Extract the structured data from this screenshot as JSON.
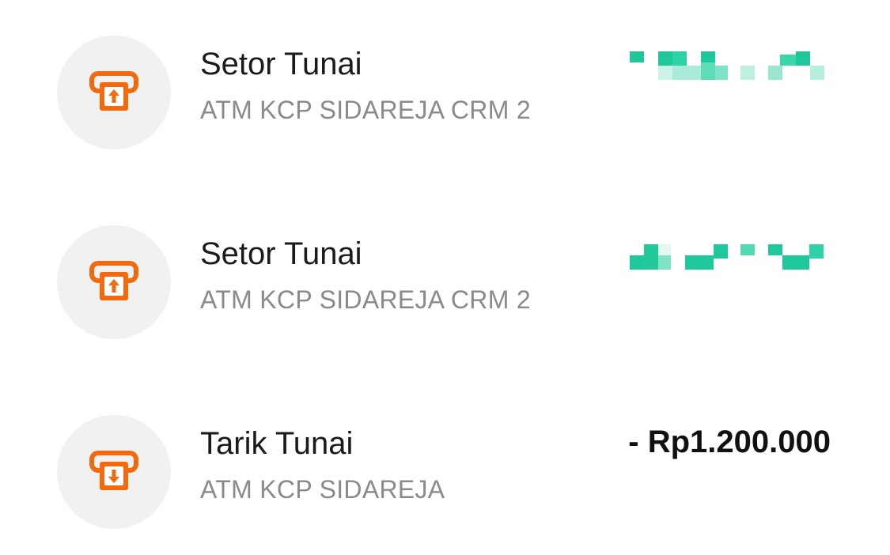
{
  "transactions": [
    {
      "icon": "atm-deposit-icon",
      "title": "Setor Tunai",
      "subtitle": "ATM KCP SIDAREJA CRM 2",
      "amount": "",
      "amount_masked": true
    },
    {
      "icon": "atm-deposit-icon",
      "title": "Setor Tunai",
      "subtitle": "ATM KCP SIDAREJA CRM 2",
      "amount": "",
      "amount_masked": true
    },
    {
      "icon": "atm-withdraw-icon",
      "title": "Tarik Tunai",
      "subtitle": "ATM KCP SIDAREJA",
      "amount": "- Rp1.200.000",
      "amount_masked": false
    }
  ],
  "colors": {
    "icon_accent": "#f26a10",
    "icon_background": "#f1f1f1",
    "title_text": "#1a1a1a",
    "subtitle_text": "#8a8a8a",
    "masked_amount": "#1ec89a"
  }
}
